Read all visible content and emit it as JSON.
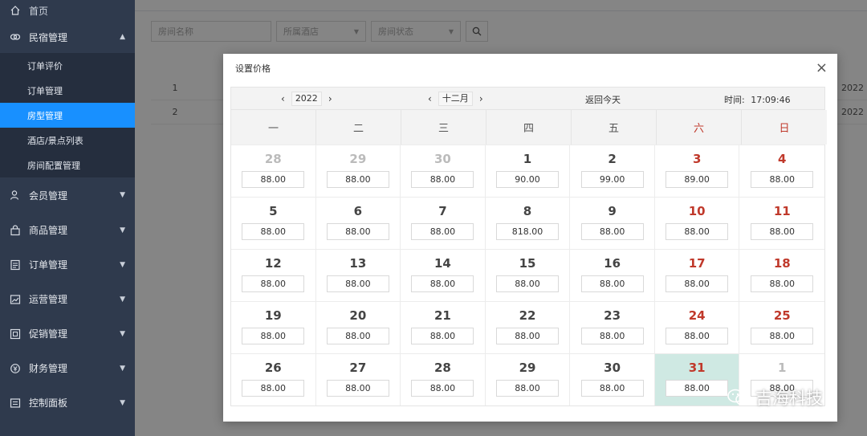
{
  "sidebar": {
    "top_item": "首页",
    "groups": [
      {
        "label": "民宿管理",
        "icon": "link-icon",
        "open": true
      },
      {
        "label": "会员管理",
        "icon": "user-icon"
      },
      {
        "label": "商品管理",
        "icon": "bag-icon"
      },
      {
        "label": "订单管理",
        "icon": "order-icon"
      },
      {
        "label": "运营管理",
        "icon": "chart-icon"
      },
      {
        "label": "促销管理",
        "icon": "promo-icon"
      },
      {
        "label": "财务管理",
        "icon": "finance-icon"
      },
      {
        "label": "控制面板",
        "icon": "panel-icon"
      }
    ],
    "sub_items": [
      "订单评价",
      "订单管理",
      "房型管理",
      "酒店/景点列表",
      "房间配置管理"
    ],
    "active_sub": "房型管理"
  },
  "background": {
    "filters": {
      "name_placeholder": "房间名称",
      "hotel_placeholder": "所属酒店",
      "status_placeholder": "房间状态"
    },
    "rows": [
      {
        "index": "1",
        "date": "2022"
      },
      {
        "index": "2",
        "date": "2022"
      }
    ]
  },
  "modal": {
    "title": "设置价格",
    "close": "×",
    "year": "2022",
    "month": "十二月",
    "today_button": "返回今天",
    "time_label": "时间:",
    "time_value": "17:09:46",
    "weekdays": [
      "一",
      "二",
      "三",
      "四",
      "五",
      "六",
      "日"
    ],
    "weeks": [
      [
        {
          "d": "28",
          "p": "88.00",
          "o": true
        },
        {
          "d": "29",
          "p": "88.00",
          "o": true
        },
        {
          "d": "30",
          "p": "88.00",
          "o": true
        },
        {
          "d": "1",
          "p": "90.00"
        },
        {
          "d": "2",
          "p": "99.00"
        },
        {
          "d": "3",
          "p": "89.00",
          "w": true
        },
        {
          "d": "4",
          "p": "88.00",
          "w": true
        }
      ],
      [
        {
          "d": "5",
          "p": "88.00"
        },
        {
          "d": "6",
          "p": "88.00"
        },
        {
          "d": "7",
          "p": "88.00"
        },
        {
          "d": "8",
          "p": "818.00"
        },
        {
          "d": "9",
          "p": "88.00"
        },
        {
          "d": "10",
          "p": "88.00",
          "w": true
        },
        {
          "d": "11",
          "p": "88.00",
          "w": true
        }
      ],
      [
        {
          "d": "12",
          "p": "88.00"
        },
        {
          "d": "13",
          "p": "88.00"
        },
        {
          "d": "14",
          "p": "88.00"
        },
        {
          "d": "15",
          "p": "88.00"
        },
        {
          "d": "16",
          "p": "88.00"
        },
        {
          "d": "17",
          "p": "88.00",
          "w": true
        },
        {
          "d": "18",
          "p": "88.00",
          "w": true
        }
      ],
      [
        {
          "d": "19",
          "p": "88.00"
        },
        {
          "d": "20",
          "p": "88.00"
        },
        {
          "d": "21",
          "p": "88.00"
        },
        {
          "d": "22",
          "p": "88.00"
        },
        {
          "d": "23",
          "p": "88.00"
        },
        {
          "d": "24",
          "p": "88.00",
          "w": true
        },
        {
          "d": "25",
          "p": "88.00",
          "w": true
        }
      ],
      [
        {
          "d": "26",
          "p": "88.00"
        },
        {
          "d": "27",
          "p": "88.00"
        },
        {
          "d": "28",
          "p": "88.00"
        },
        {
          "d": "29",
          "p": "88.00"
        },
        {
          "d": "30",
          "p": "88.00"
        },
        {
          "d": "31",
          "p": "88.00",
          "w": true,
          "s": true
        },
        {
          "d": "1",
          "p": "88.00",
          "w": true,
          "o": true
        }
      ]
    ],
    "weekend_color": "#c0392b",
    "selected_color": "#cfe9e3"
  },
  "watermark": "吉海科技",
  "accent": "#1890ff"
}
